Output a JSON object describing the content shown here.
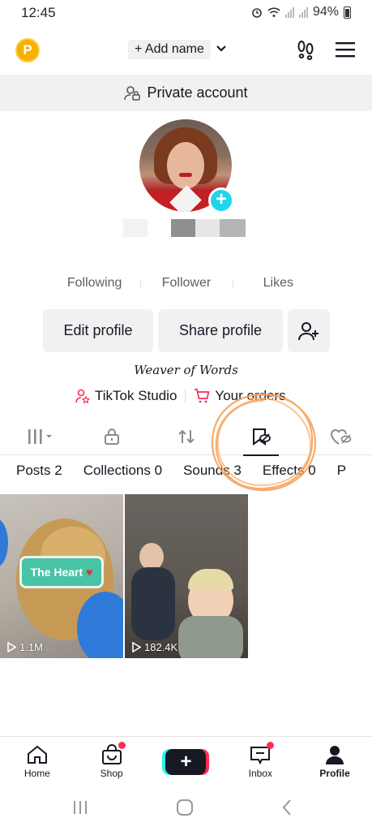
{
  "status_bar": {
    "time": "12:45",
    "battery": "94%"
  },
  "header": {
    "coin_letter": "P",
    "add_name_label": "+ Add name"
  },
  "private_bar": {
    "label": "Private account"
  },
  "stats": {
    "following_label": "Following",
    "followers_label": "Follower",
    "likes_label": "Likes"
  },
  "buttons": {
    "edit_label": "Edit profile",
    "share_label": "Share profile"
  },
  "bio": "Weaver of Words",
  "links": {
    "studio_label": "TikTok Studio",
    "orders_label": "Your orders"
  },
  "subtabs": [
    {
      "label": "Posts 2"
    },
    {
      "label": "Collections 0"
    },
    {
      "label": "Sounds 3"
    },
    {
      "label": "Effects 0"
    },
    {
      "label": "P"
    }
  ],
  "videos": [
    {
      "views": "1.1M",
      "overlay_text": "The Heart"
    },
    {
      "views": "182.4K"
    }
  ],
  "bottom_nav": {
    "home": "Home",
    "shop": "Shop",
    "inbox": "Inbox",
    "profile": "Profile",
    "create_symbol": "+"
  },
  "colors": {
    "accent_red": "#fe2c55",
    "accent_cyan": "#25f4ee",
    "annotation_orange": "#f5a35c"
  }
}
